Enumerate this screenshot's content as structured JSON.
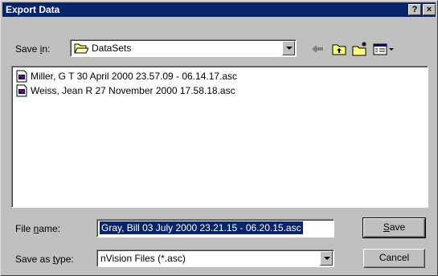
{
  "window": {
    "title": "Export Data",
    "help_label": "?",
    "close_label": "×"
  },
  "save_in": {
    "label_pre": "Save ",
    "label_mnemonic": "i",
    "label_post": "n:",
    "value": "DataSets"
  },
  "toolbar": {
    "icons": [
      "back-arrow-icon",
      "up-one-level-icon",
      "new-folder-icon",
      "view-menu-icon"
    ]
  },
  "files": [
    {
      "name": "Miller, G T 30 April 2000 23.57.09 - 06.14.17.asc"
    },
    {
      "name": "Weiss, Jean R 27 November 2000 17.58.18.asc"
    }
  ],
  "file_name": {
    "label_pre": "File ",
    "label_mnemonic": "n",
    "label_post": "ame:",
    "value": "Gray, Bill  03 July 2000 23.21.15 - 06.20.15.asc"
  },
  "save_as_type": {
    "label_pre": "Save as ",
    "label_mnemonic": "t",
    "label_post": "ype:",
    "value": "nVision Files (*.asc)"
  },
  "buttons": {
    "save_mnemonic": "S",
    "save_rest": "ave",
    "cancel": "Cancel"
  },
  "colors": {
    "titlebar": "#0a246a",
    "face": "#c0c0c0",
    "selection": "#0a246a"
  }
}
